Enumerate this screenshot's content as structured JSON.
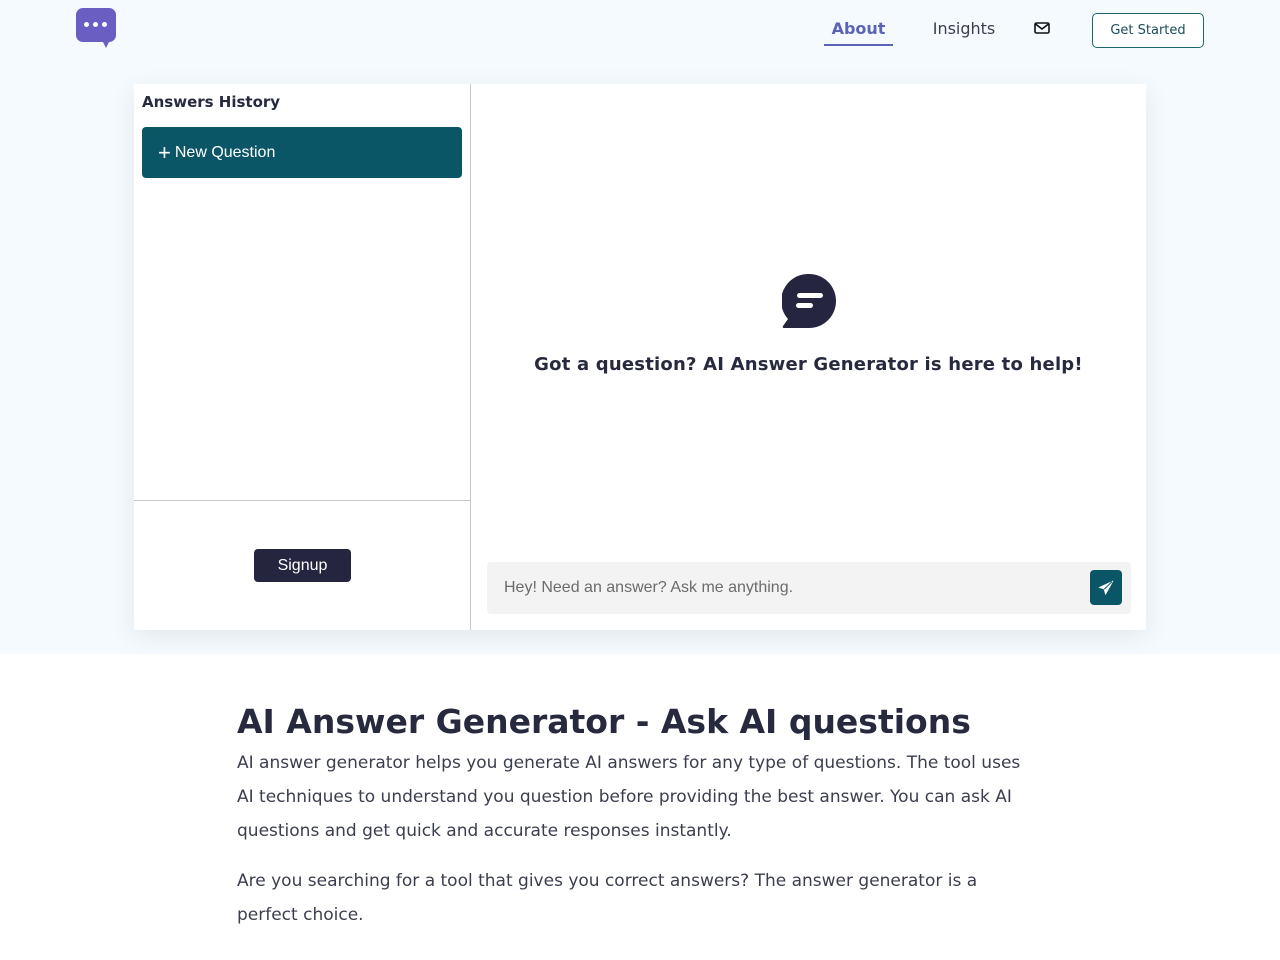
{
  "header": {
    "logo_icon": "chat-dots-icon",
    "nav": {
      "about": "About",
      "insights": "Insights",
      "mail_icon": "envelope-icon"
    },
    "get_started": "Get Started"
  },
  "sidebar": {
    "title": "Answers History",
    "new_question": "New Question",
    "signup": "Signup"
  },
  "main": {
    "chat_icon": "chat-bubble-icon",
    "prompt": "Got a question? AI Answer Generator is here to help!",
    "input_placeholder": "Hey! Need an answer? Ask me anything.",
    "send_icon": "paper-plane-icon"
  },
  "article": {
    "title": "AI Answer Generator - Ask AI questions",
    "p1": "AI answer generator helps you generate AI answers for any type of questions. The tool uses AI techniques to understand you question before providing the best answer. You can ask AI questions and get quick and accurate responses instantly.",
    "p2": "Are you searching for a tool that gives you correct answers? The answer generator is a perfect choice."
  },
  "colors": {
    "brand_purple": "#6b5ec2",
    "nav_active": "#5a63b8",
    "teal": "#0b5666",
    "dark": "#262540",
    "hero_bg": "#f4fafd"
  }
}
